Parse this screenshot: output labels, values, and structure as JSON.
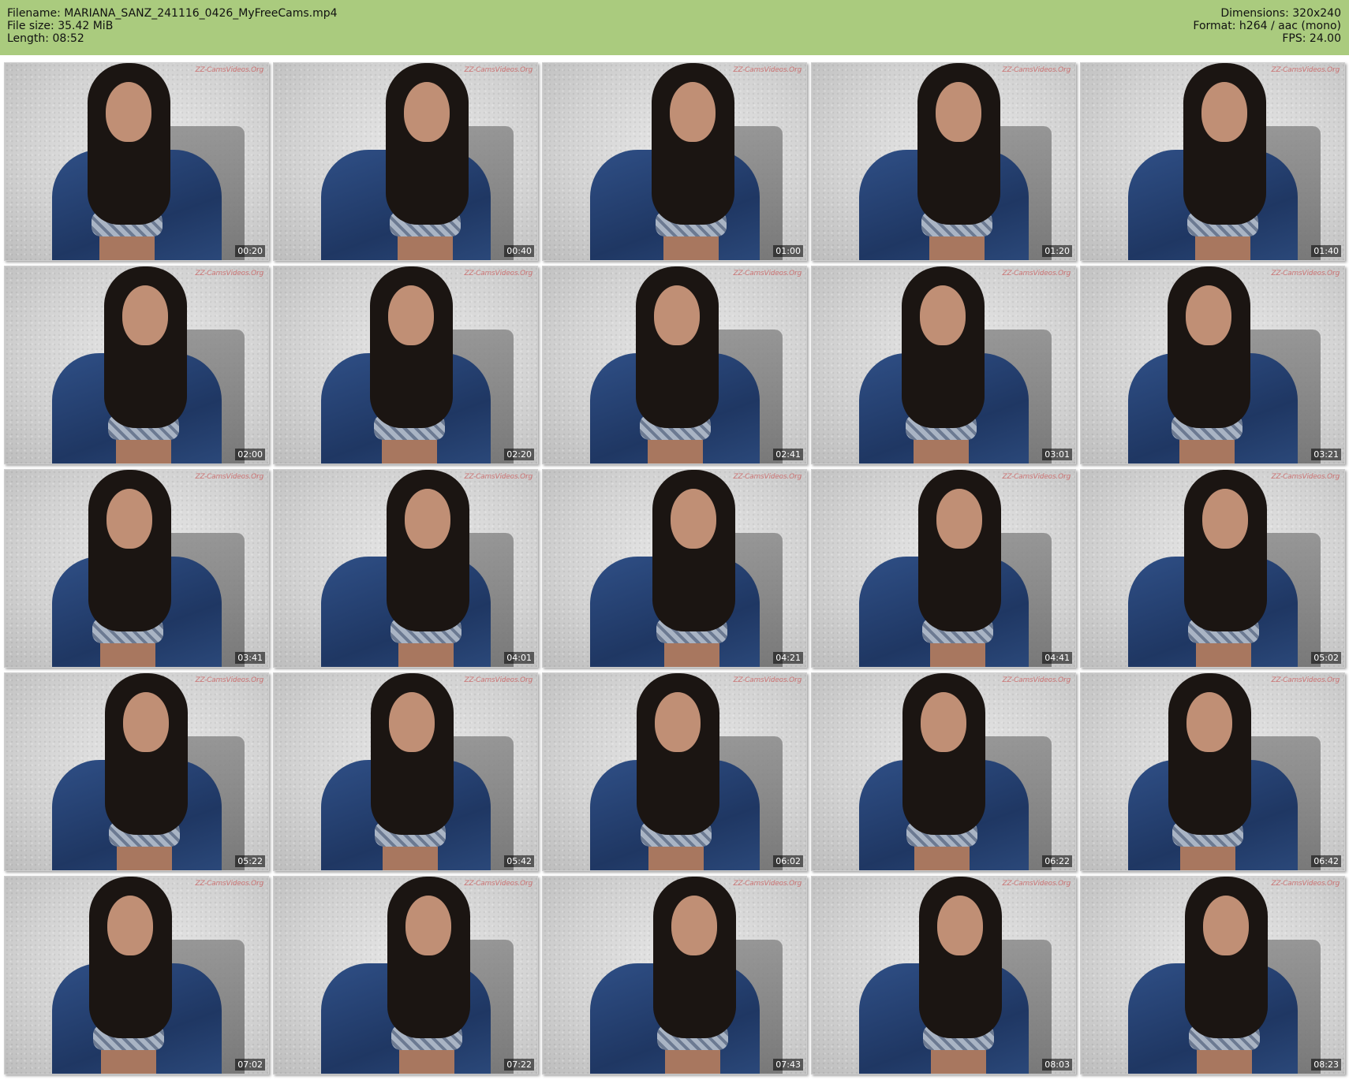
{
  "header": {
    "filename_line": "Filename: MARIANA_SANZ_241116_0426_MyFreeCams.mp4",
    "filesize_line": "File size: 35.42 MiB",
    "length_line": "Length: 08:52",
    "dimensions_line": "Dimensions: 320x240",
    "format_line": "Format: h264 / aac (mono)",
    "fps_line": "FPS: 24.00"
  },
  "colors": {
    "header_background": "#aacb7e",
    "timestamp_background": "#000000"
  },
  "watermark_text": "ZZ-CamsVideos.Org",
  "thumbnails": [
    {
      "timestamp": "00:20"
    },
    {
      "timestamp": "00:40"
    },
    {
      "timestamp": "01:00"
    },
    {
      "timestamp": "01:20"
    },
    {
      "timestamp": "01:40"
    },
    {
      "timestamp": "02:00"
    },
    {
      "timestamp": "02:20"
    },
    {
      "timestamp": "02:41"
    },
    {
      "timestamp": "03:01"
    },
    {
      "timestamp": "03:21"
    },
    {
      "timestamp": "03:41"
    },
    {
      "timestamp": "04:01"
    },
    {
      "timestamp": "04:21"
    },
    {
      "timestamp": "04:41"
    },
    {
      "timestamp": "05:02"
    },
    {
      "timestamp": "05:22"
    },
    {
      "timestamp": "05:42"
    },
    {
      "timestamp": "06:02"
    },
    {
      "timestamp": "06:22"
    },
    {
      "timestamp": "06:42"
    },
    {
      "timestamp": "07:02"
    },
    {
      "timestamp": "07:22"
    },
    {
      "timestamp": "07:43"
    },
    {
      "timestamp": "08:03"
    },
    {
      "timestamp": "08:23"
    }
  ]
}
